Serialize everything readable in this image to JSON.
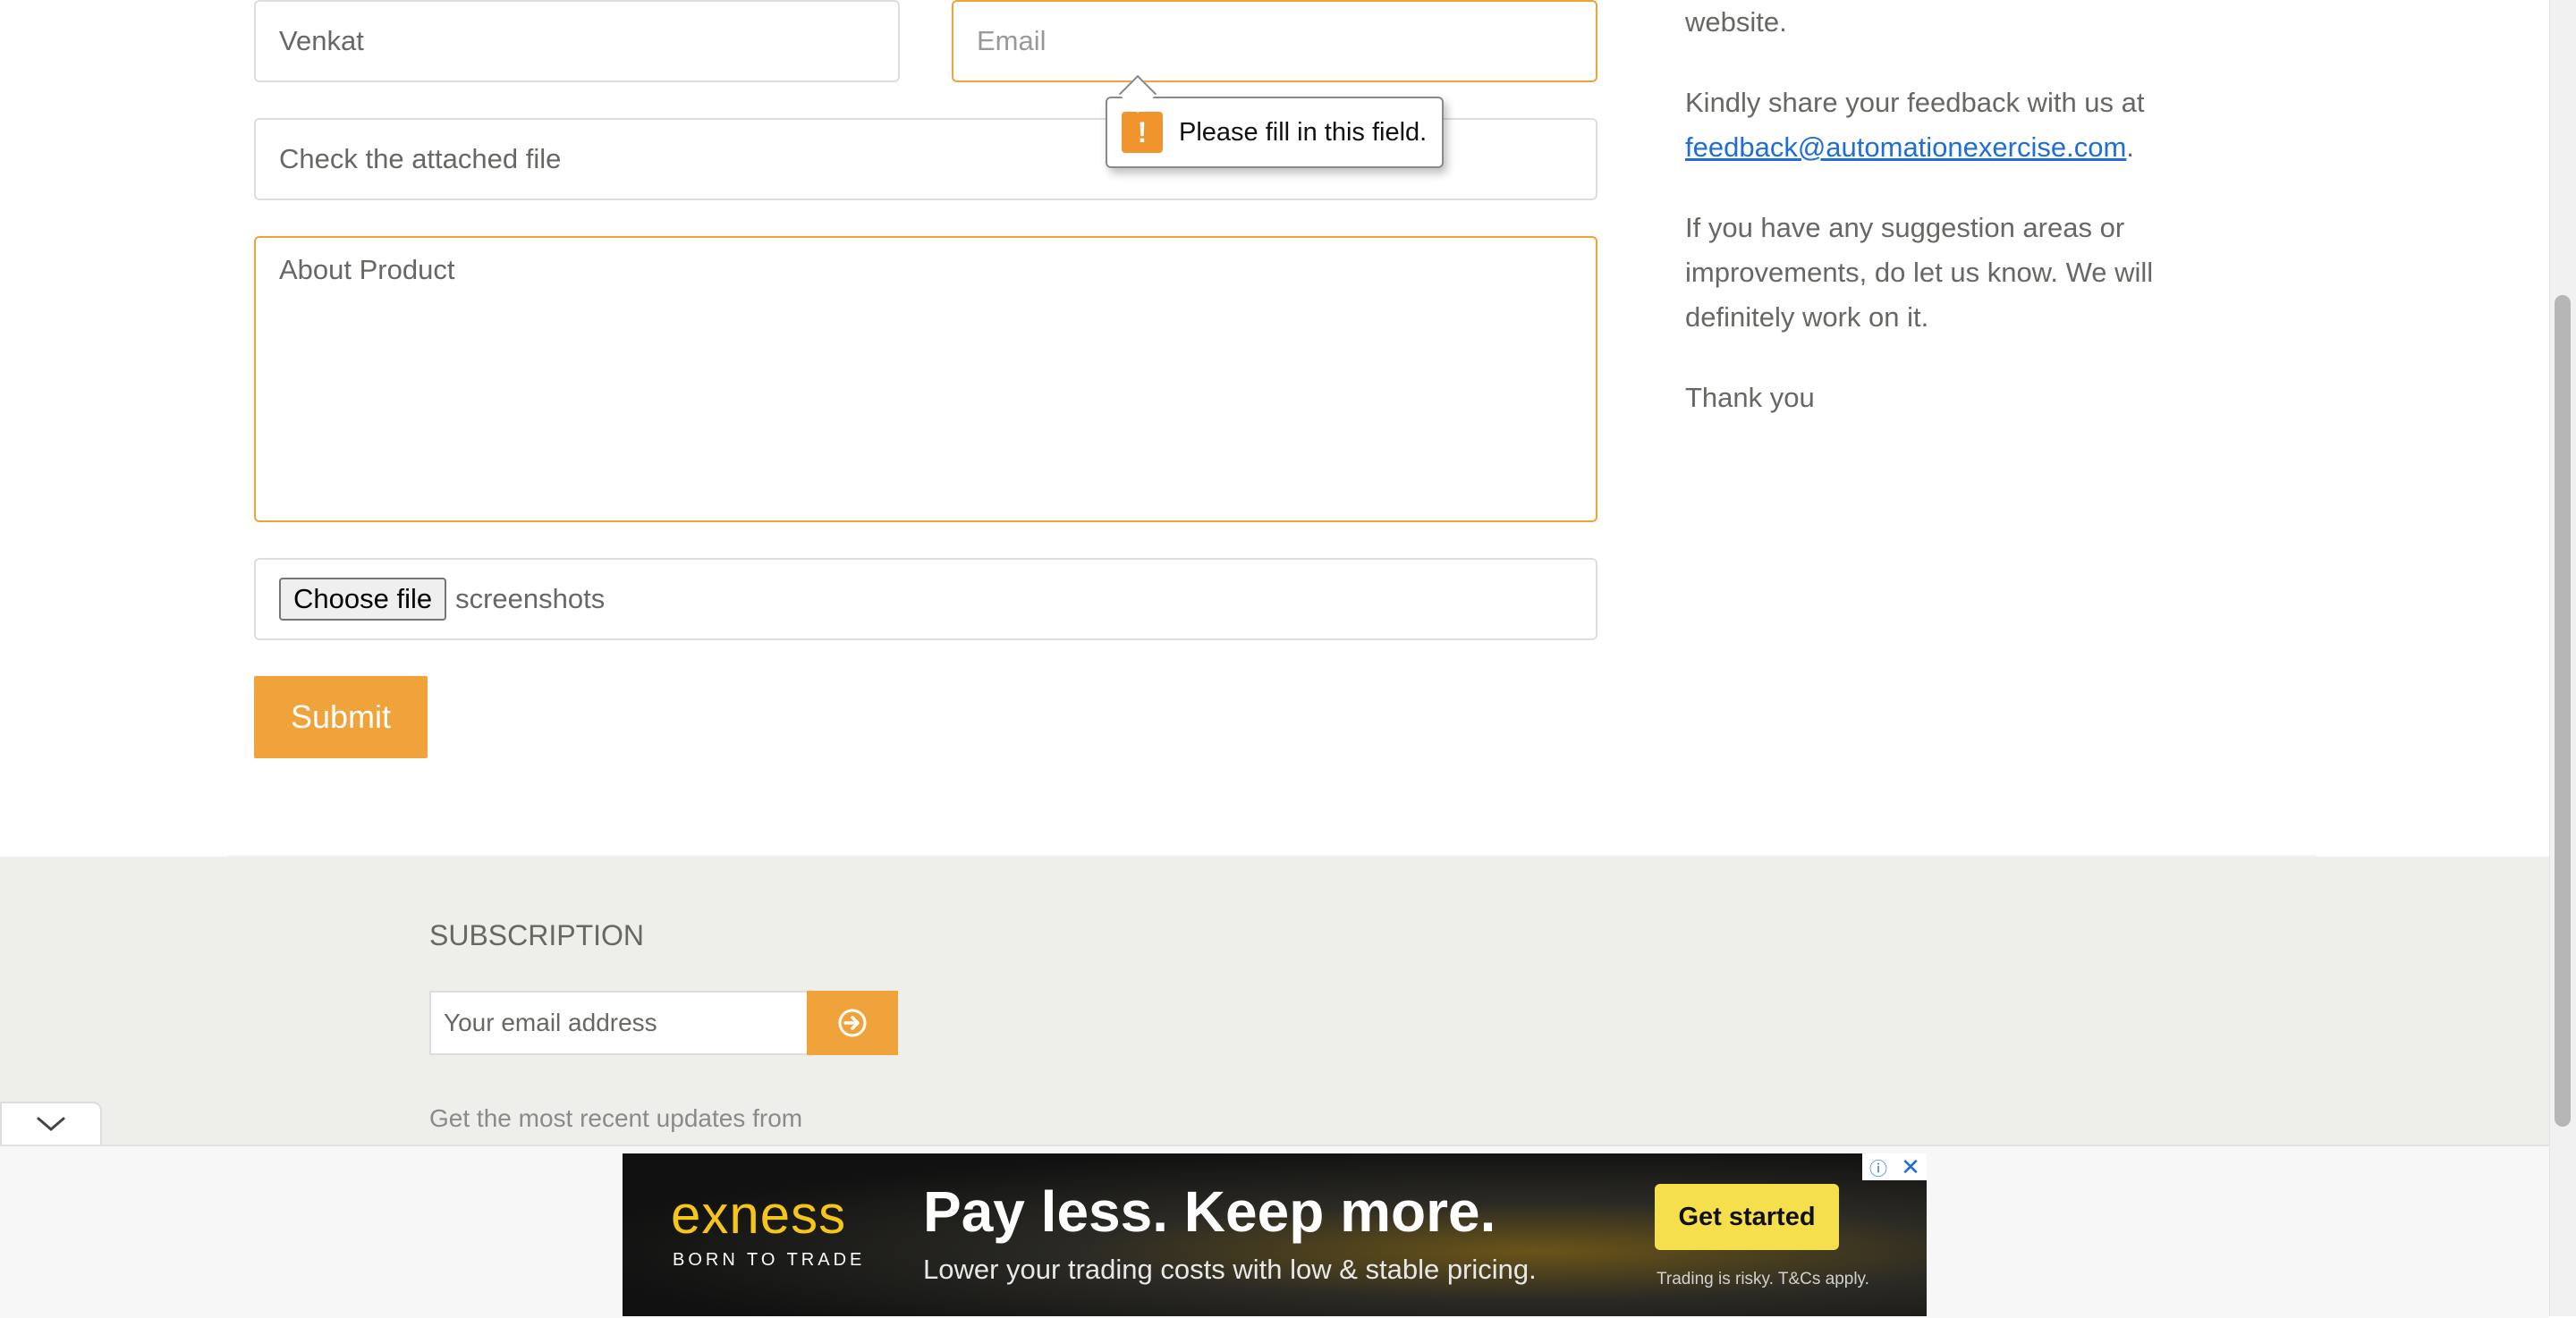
{
  "form": {
    "name_value": "Venkat",
    "email_placeholder": "Email",
    "subject_value": "Check the attached file",
    "message_value": "About Product",
    "choose_file_label": "Choose file",
    "file_name": "screenshots",
    "submit_label": "Submit",
    "validation_tooltip": "Please fill in this field.",
    "validation_icon": "!"
  },
  "side": {
    "website_tail": "website.",
    "feedback_prefix": "Kindly share your feedback with us at",
    "feedback_email": "feedback@automationexercise.com",
    "feedback_suffix": ".",
    "suggestion": "If you have any suggestion areas or improvements, do let us know. We will definitely work on it.",
    "thanks": "Thank you"
  },
  "footer": {
    "subscription_title": "SUBSCRIPTION",
    "email_placeholder": "Your email address",
    "description": "Get the most recent updates from"
  },
  "ad": {
    "logo": "exness",
    "tagline": "BORN TO TRADE",
    "headline": "Pay less. Keep more.",
    "subline": "Lower your trading costs with low & stable pricing.",
    "cta": "Get started",
    "disclaimer": "Trading is risky. T&Cs apply.",
    "info_icon": "ⓘ",
    "close_icon": "✕"
  },
  "colors": {
    "accent": "#f0a33a",
    "footer_bg": "#eeeeea",
    "link": "#1e6ed6"
  }
}
